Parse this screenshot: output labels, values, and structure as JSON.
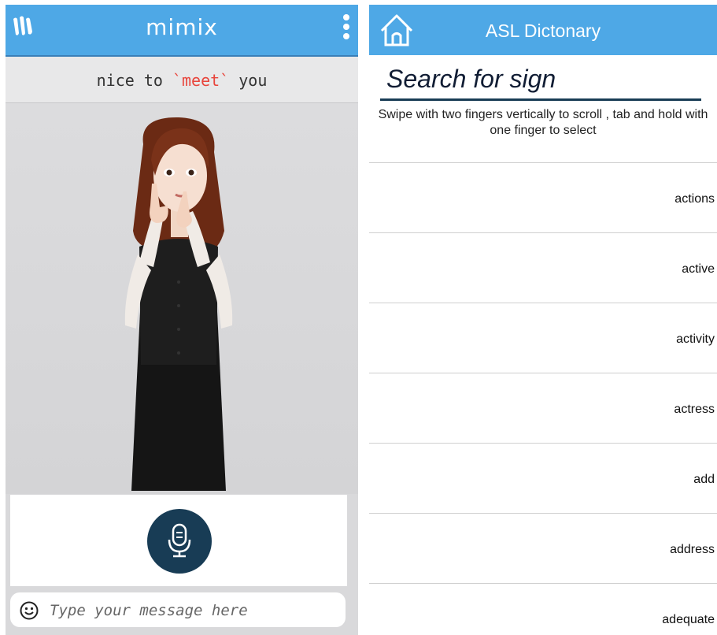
{
  "left_app": {
    "brand": "mimix",
    "phrase": {
      "before": "nice to ",
      "highlight": "`meet`",
      "after": " you"
    },
    "message_placeholder": "Type your message here",
    "icons": {
      "logo": "mimix-logo-icon",
      "menu": "kebab-menu-icon",
      "mic": "microphone-icon",
      "emoji": "smiley-icon"
    }
  },
  "right_app": {
    "title": "ASL Dictonary",
    "search_heading": "Search for sign",
    "instructions": "Swipe with two fingers vertically to scroll , tab and hold with one finger to select",
    "words": [
      "actions",
      "active",
      "activity",
      "actress",
      "add",
      "address",
      "adequate"
    ],
    "icons": {
      "home": "home-icon"
    }
  },
  "colors": {
    "header_blue": "#4ea8e6",
    "mic_button": "#183c55",
    "highlight_red": "#e8453c"
  }
}
